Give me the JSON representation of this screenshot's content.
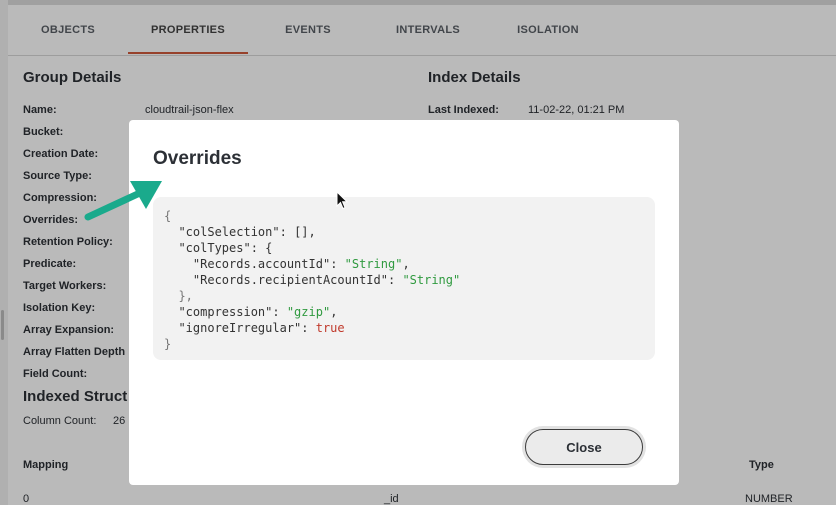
{
  "tabs": [
    {
      "label": "OBJECTS",
      "active": false
    },
    {
      "label": "PROPERTIES",
      "active": true
    },
    {
      "label": "EVENTS",
      "active": false
    },
    {
      "label": "INTERVALS",
      "active": false
    },
    {
      "label": "ISOLATION",
      "active": false
    }
  ],
  "group_details": {
    "title": "Group Details",
    "fields": [
      {
        "label": "Name:",
        "value": "cloudtrail-json-flex"
      },
      {
        "label": "Bucket:",
        "value": ""
      },
      {
        "label": "Creation Date:",
        "value": ""
      },
      {
        "label": "Source Type:",
        "value": ""
      },
      {
        "label": "Compression:",
        "value": ""
      },
      {
        "label": "Overrides:",
        "value": ""
      },
      {
        "label": "Retention Policy:",
        "value": ""
      },
      {
        "label": "Predicate:",
        "value": ""
      },
      {
        "label": "Target Workers:",
        "value": ""
      },
      {
        "label": "Isolation Key:",
        "value": ""
      },
      {
        "label": "Array Expansion:",
        "value": ""
      },
      {
        "label": "Array Flatten Depth",
        "value": ""
      },
      {
        "label": "Field Count:",
        "value": ""
      }
    ]
  },
  "index_details": {
    "title": "Index Details",
    "last_indexed_label": "Last Indexed:",
    "last_indexed_value": "11-02-22, 01:21 PM"
  },
  "indexed_structure": {
    "title": "Indexed Struct",
    "column_count_label": "Column Count:",
    "column_count_value": "26"
  },
  "table": {
    "headers": {
      "mapping": "Mapping",
      "type": "Type"
    },
    "first_row": {
      "mapping": "0",
      "name": "_id",
      "type": "NUMBER"
    }
  },
  "modal": {
    "title": "Overrides",
    "close_label": "Close",
    "code": {
      "open_brace": "{",
      "col_selection_key": "\"colSelection\"",
      "col_selection_value": "[],",
      "col_types_key": "\"colTypes\"",
      "col_types_open": "{",
      "account_id_key": "\"Records.accountId\"",
      "account_id_value": "\"String\"",
      "recipient_key": "\"Records.recipientAcountId\"",
      "recipient_value": "\"String\"",
      "col_types_close": "},",
      "compression_key": "\"compression\"",
      "compression_value": "\"gzip\"",
      "ignore_key": "\"ignoreIrregular\"",
      "ignore_value": "true",
      "close_brace": "}"
    }
  },
  "colors": {
    "tab_accent": "#cf5a3b",
    "annotation_arrow": "#1aaa8c",
    "json_string": "#2f9a3f",
    "json_boolean": "#c0392b"
  },
  "icons": [
    "annotation-arrow-icon",
    "mouse-cursor-icon"
  ]
}
